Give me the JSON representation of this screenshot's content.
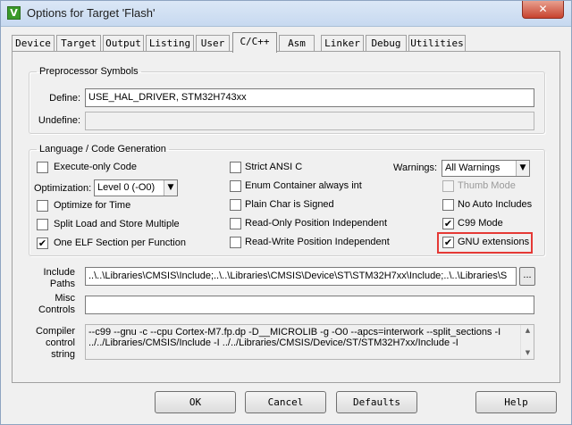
{
  "window": {
    "title": "Options for Target 'Flash'",
    "close_glyph": "✕",
    "app_icon_glyph": "V"
  },
  "tabs": [
    {
      "label": "Device"
    },
    {
      "label": "Target"
    },
    {
      "label": "Output"
    },
    {
      "label": "Listing"
    },
    {
      "label": "User"
    },
    {
      "label": "C/C++",
      "active": true
    },
    {
      "label": "Asm"
    },
    {
      "label": "Linker"
    },
    {
      "label": "Debug"
    },
    {
      "label": "Utilities"
    }
  ],
  "preprocessor": {
    "legend": "Preprocessor Symbols",
    "define_label": "Define:",
    "define_value": "USE_HAL_DRIVER, STM32H743xx",
    "undefine_label": "Undefine:",
    "undefine_value": ""
  },
  "language": {
    "legend": "Language / Code Generation",
    "execute_only": {
      "label": "Execute-only Code",
      "checked": false
    },
    "optimization_label": "Optimization:",
    "optimization_value": "Level 0 (-O0)",
    "optimize_time": {
      "label": "Optimize for Time",
      "checked": false
    },
    "split_load": {
      "label": "Split Load and Store Multiple",
      "checked": false
    },
    "one_elf": {
      "label": "One ELF Section per Function",
      "checked": true
    },
    "strict_ansi": {
      "label": "Strict ANSI C",
      "checked": false
    },
    "enum_container": {
      "label": "Enum Container always int",
      "checked": false
    },
    "plain_char": {
      "label": "Plain Char is Signed",
      "checked": false
    },
    "ro_pos": {
      "label": "Read-Only Position Independent",
      "checked": false
    },
    "rw_pos": {
      "label": "Read-Write Position Independent",
      "checked": false
    },
    "warnings_label": "Warnings:",
    "warnings_value": "All Warnings",
    "thumb_mode": {
      "label": "Thumb Mode",
      "checked": false,
      "disabled": true
    },
    "no_auto_includes": {
      "label": "No Auto Includes",
      "checked": false
    },
    "c99_mode": {
      "label": "C99 Mode",
      "checked": true
    },
    "gnu_extensions": {
      "label": "GNU extensions",
      "checked": true
    },
    "highlight_color": "#e53935"
  },
  "include": {
    "label_line1": "Include",
    "label_line2": "Paths",
    "value": "..\\..\\Libraries\\CMSIS\\Include;..\\..\\Libraries\\CMSIS\\Device\\ST\\STM32H7xx\\Include;..\\..\\Libraries\\S",
    "browse_label": "..."
  },
  "misc": {
    "label_line1": "Misc",
    "label_line2": "Controls",
    "value": ""
  },
  "compiler": {
    "label_line1": "Compiler",
    "label_line2": "control",
    "label_line3": "string",
    "line1": "--c99 --gnu -c --cpu Cortex-M7.fp.dp -D__MICROLIB -g -O0 --apcs=interwork --split_sections -I",
    "line2": "../../Libraries/CMSIS/Include -I ../../Libraries/CMSIS/Device/ST/STM32H7xx/Include -I"
  },
  "buttons": {
    "ok": "OK",
    "cancel": "Cancel",
    "defaults": "Defaults",
    "help": "Help"
  },
  "check_glyph": "✔"
}
